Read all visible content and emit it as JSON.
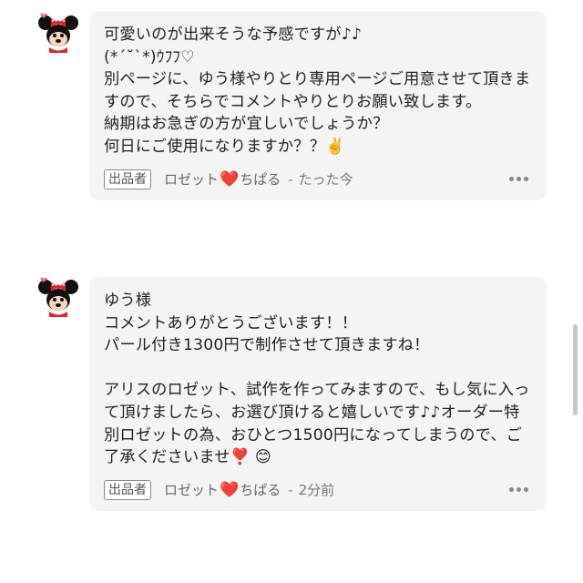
{
  "comments": [
    {
      "text": "可愛いのが出来そうな予感ですが♪♪\n(*´˘`*)ｳﾌﾌ♡\n別ページに、ゆう様やりとり専用ページご用意させて頂きますので、そちらでコメントやりとりお願い致します。\n納期はお急ぎの方が宜しいでしょうか？\n何日にご使用になりますか？？✌️",
      "badge": "出品者",
      "author_a": "ロゼット",
      "heart": "❤️",
      "author_b": "ちぱる",
      "sep": "-",
      "time": "たった今",
      "avatar_icon": "minnie-mouse-avatar"
    },
    {
      "text": "ゆう様\nコメントありがとうございます！！\nパール付き1300円で制作させて頂きますね！\n\nアリスのロゼット、試作を作ってみますので、もし気に入って頂けましたら、お選び頂けると嬉しいです♪♪オーダー特別ロゼットの為、おひとつ1500円になってしまうので、ご了承くださいませ❣️ 😊",
      "badge": "出品者",
      "author_a": "ロゼット",
      "heart": "❤️",
      "author_b": "ちぱる",
      "sep": "-",
      "time": "2分前",
      "avatar_icon": "minnie-mouse-avatar"
    }
  ],
  "colors": {
    "bubble_bg": "#f4f4f4",
    "heart": "#e0242a",
    "meta_text": "#777777"
  }
}
